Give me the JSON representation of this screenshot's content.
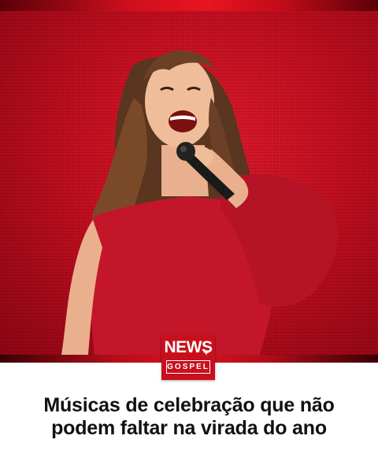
{
  "photo": {
    "subject": "singer-performing-with-microphone"
  },
  "logo": {
    "word_top": "NEWS",
    "word_bottom": "GOSPEL",
    "color": "#c8101c"
  },
  "headline": {
    "line1": "Músicas de celebração que não",
    "line2": "podem faltar na virada do ano"
  },
  "colors": {
    "accent": "#d0101e",
    "background": "#ffffff",
    "text": "#111111"
  }
}
